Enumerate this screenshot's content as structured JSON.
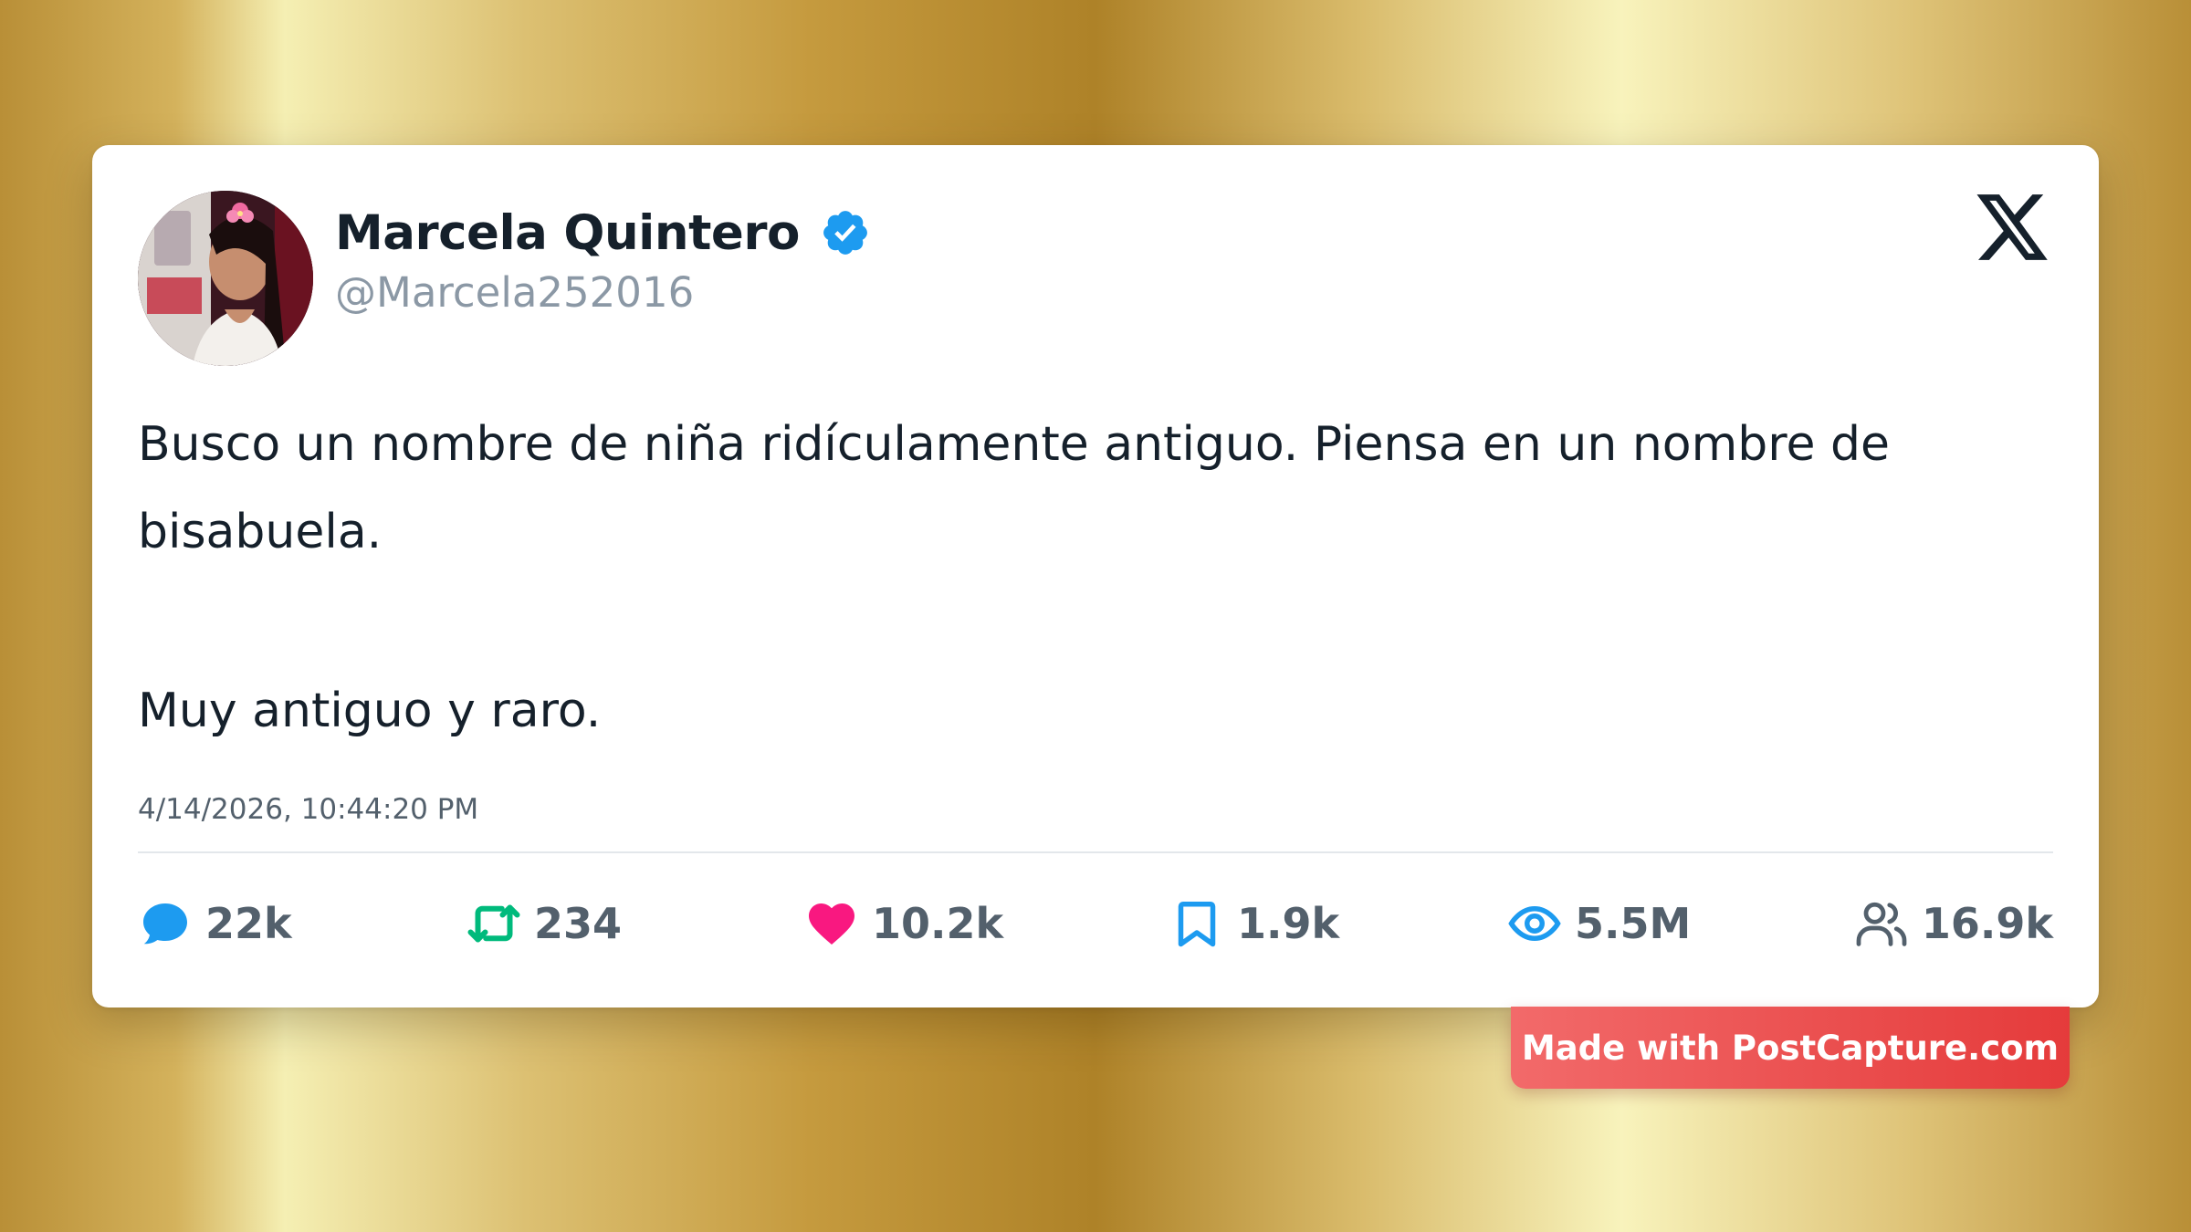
{
  "author": {
    "display_name": "Marcela Quintero",
    "handle": "@Marcela252016",
    "verified": true
  },
  "tweet": {
    "paragraphs": [
      "Busco un nombre de niña ridículamente antiguo. Piensa en un nombre de bisabuela.",
      "Muy antiguo y raro."
    ],
    "timestamp": "4/14/2026, 10:44:20 PM"
  },
  "stats": {
    "replies": "22k",
    "retweets": "234",
    "likes": "10.2k",
    "bookmarks": "1.9k",
    "views": "5.5M",
    "followers": "16.9k"
  },
  "icons": {
    "platform_logo": "x-logo-icon",
    "verified": "verified-badge-icon",
    "replies": "reply-bubble-icon",
    "retweets": "retweet-icon",
    "likes": "heart-icon",
    "bookmarks": "bookmark-icon",
    "views": "eye-icon",
    "followers": "users-icon"
  },
  "colors": {
    "reply": "#1d9bf0",
    "retweet": "#00ba7c",
    "like": "#f91880",
    "bookmark": "#1d9bf0",
    "views": "#1d9bf0",
    "followers": "#53606c",
    "verified": "#1d9bf0",
    "badge": "#e53b3b"
  },
  "watermark": {
    "label": "Made with PostCapture.com"
  }
}
